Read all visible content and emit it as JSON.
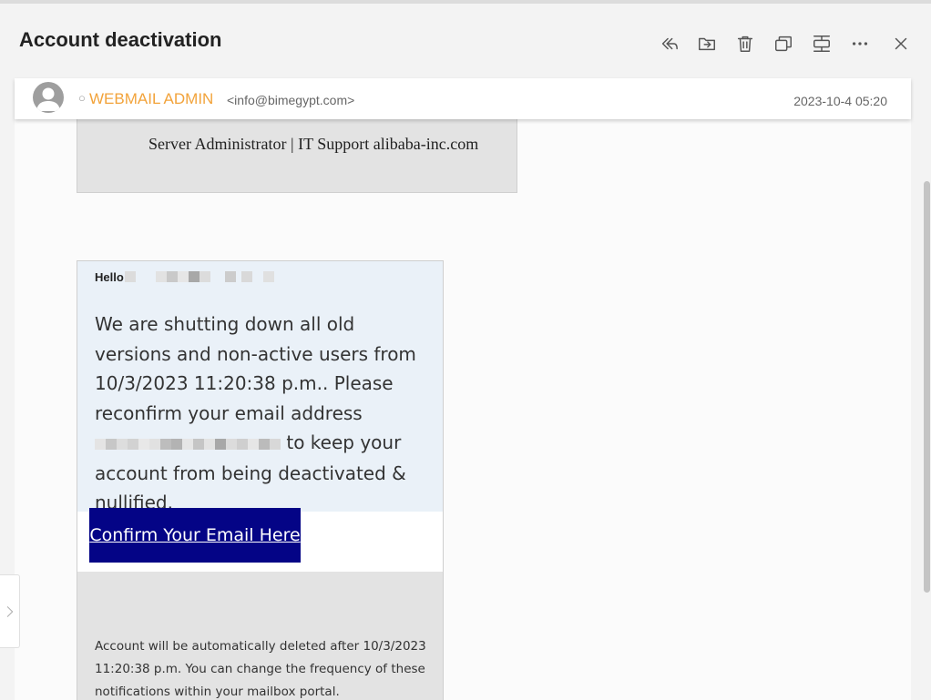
{
  "header": {
    "title": "Account deactivation"
  },
  "toolbar": {
    "icons": [
      "reply-all-icon",
      "move-to-folder-icon",
      "delete-icon",
      "open-new-window-icon",
      "split-view-icon",
      "more-icon",
      "close-icon"
    ]
  },
  "message": {
    "sender_status": "○",
    "sender_name": "WEBMAIL ADMIN",
    "sender_email": "<info@bimegypt.com>",
    "date": "2023-10-4 05:20",
    "banner_text": "Server Administrator | IT Support alibaba-inc.com",
    "greeting": "Hello",
    "body_part1": "We are shutting down all old versions and non-active users  from 10/3/2023 11:20:38 p.m.. Please reconfirm your email address",
    "body_part2": " to keep your account from being deactivated & nullified.",
    "confirm_button": "Confirm Your Email Here",
    "footer": "Account will be  automatically deleted after 10/3/2023 11:20:38 p.m. You can change the frequency of these notifications within your mailbox portal."
  },
  "colors": {
    "sender_name": "#f2a33b",
    "button_bg": "#040486",
    "card_blue": "#eaf1f8",
    "card_gray": "#e3e3e3"
  }
}
